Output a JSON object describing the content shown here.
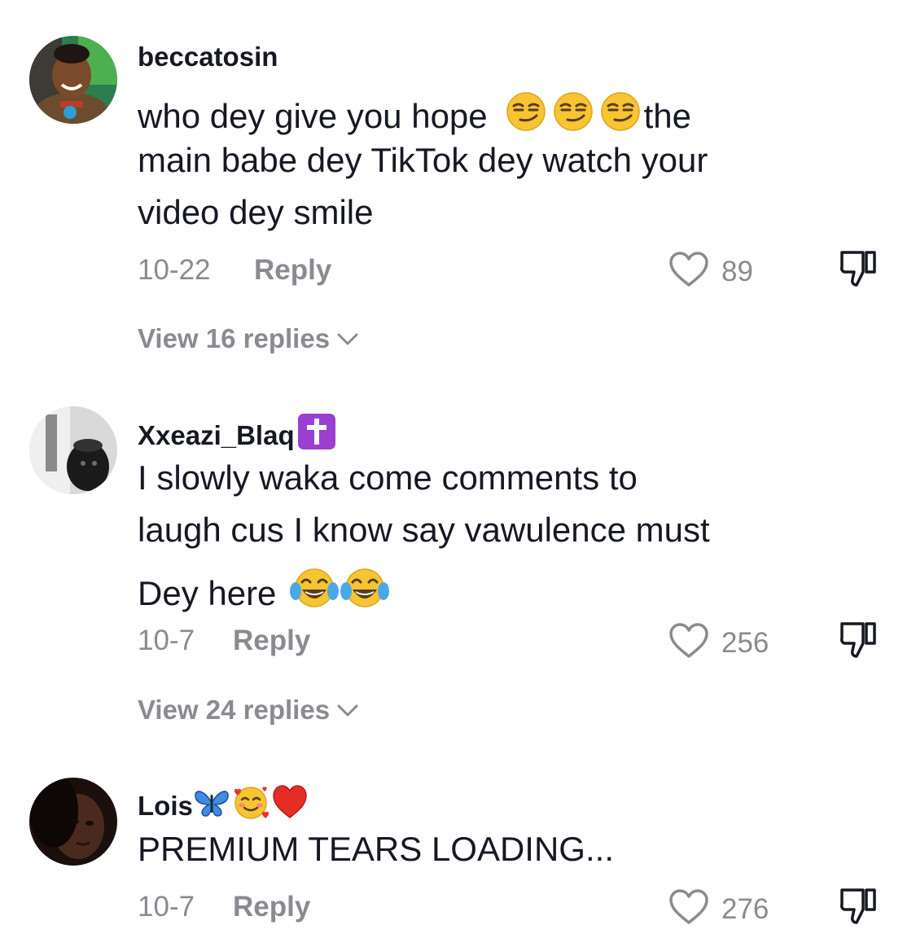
{
  "comments": [
    {
      "username": "beccatosin",
      "text_lines": [
        "who dey give you hope",
        "the",
        "main babe dey TikTok dey watch your",
        "video dey smile"
      ],
      "emojis": [
        "smirking-face",
        "smirking-face",
        "smirking-face"
      ],
      "date": "10-22",
      "reply_label": "Reply",
      "likes": "89",
      "view_replies": "View 16 replies"
    },
    {
      "username": "Xxeazi_Blaq",
      "username_emojis": [
        "latin-cross"
      ],
      "text_lines": [
        "I slowly waka come comments to",
        "laugh cus I know say vawulence must",
        "Dey here"
      ],
      "emojis": [
        "face-with-tears-of-joy",
        "face-with-tears-of-joy"
      ],
      "date": "10-7",
      "reply_label": "Reply",
      "likes": "256",
      "view_replies": "View 24 replies"
    },
    {
      "username": "Lois",
      "username_emojis": [
        "blue-butterfly",
        "smiling-face-with-hearts",
        "red-heart"
      ],
      "text_lines": [
        "PREMIUM TEARS LOADING..."
      ],
      "date": "10-7",
      "reply_label": "Reply",
      "likes": "276"
    }
  ],
  "colors": {
    "primary_text": "#161823",
    "secondary_text": "#8a8b91",
    "background": "#ffffff"
  }
}
